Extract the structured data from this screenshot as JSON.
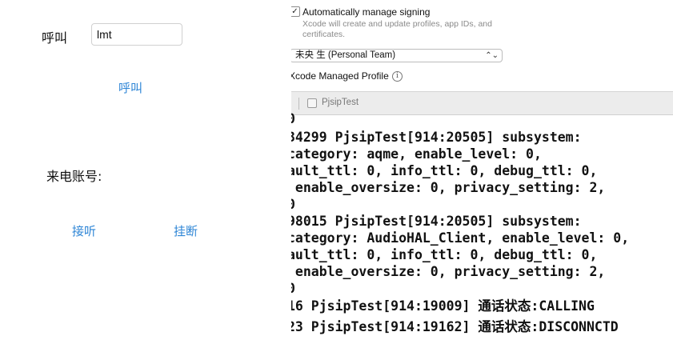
{
  "app": {
    "call_label": "呼叫",
    "account_value": "lmt",
    "call_button": "呼叫",
    "incoming_label": "来电账号:",
    "answer_button": "接听",
    "hangup_button": "挂断"
  },
  "signing": {
    "checkbox_mark": "✓",
    "auto_manage_label": "Automatically manage signing",
    "auto_manage_desc": "Xcode will create and update profiles, app IDs, and certificates.",
    "team_value": "未央 生 (Personal Team)",
    "profile_label": "Xcode Managed Profile",
    "info_icon": "info-icon"
  },
  "console": {
    "edge_glyph": "⁞",
    "target_label": "PjsipTest",
    "lines": [
      "0",
      "34299 PjsipTest[914:20505] subsystem:",
      "category: aqme, enable_level: 0,",
      "ault_ttl: 0, info_ttl: 0, debug_ttl: 0,",
      " enable_oversize: 0, privacy_setting: 2,",
      "0",
      "98015 PjsipTest[914:20505] subsystem:",
      "category: AudioHAL_Client, enable_level: 0,",
      "ault_ttl: 0, info_ttl: 0, debug_ttl: 0,",
      " enable_oversize: 0, privacy_setting: 2,",
      "0",
      "16 PjsipTest[914:19009] 通话状态:CALLING",
      "23 PjsipTest[914:19162] 通话状态:DISCONNCTD"
    ]
  },
  "colors": {
    "link_blue": "#2f86d6",
    "toolbar_gray": "#ececec"
  }
}
